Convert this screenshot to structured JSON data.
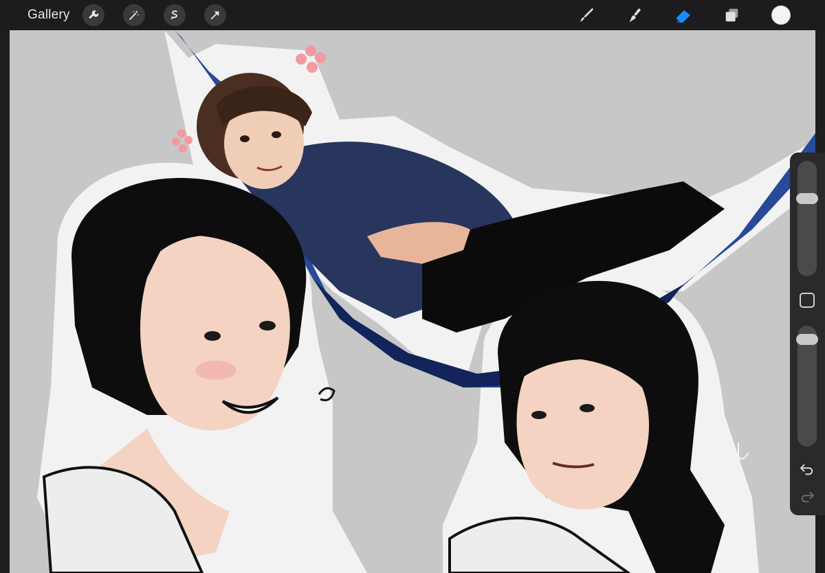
{
  "toolbar": {
    "gallery_label": "Gallery",
    "left_tools": [
      "wrench-icon",
      "magic-wand-icon",
      "selection-icon",
      "transform-arrow-icon"
    ],
    "right_tools": [
      "brush-icon",
      "smudge-icon",
      "eraser-icon",
      "layers-icon"
    ],
    "active_tool": "eraser-icon",
    "current_color": "#f4f4f4",
    "accent_color": "#1a8cff"
  },
  "canvas": {
    "background_color": "#c7c7c7",
    "artwork": "three-portrait-sketches"
  },
  "sidebar": {
    "brush_size_level": 0.7,
    "opacity_level": 0.95,
    "controls": [
      "brush-size-slider",
      "modify-button",
      "opacity-slider",
      "undo-icon",
      "redo-icon"
    ]
  }
}
